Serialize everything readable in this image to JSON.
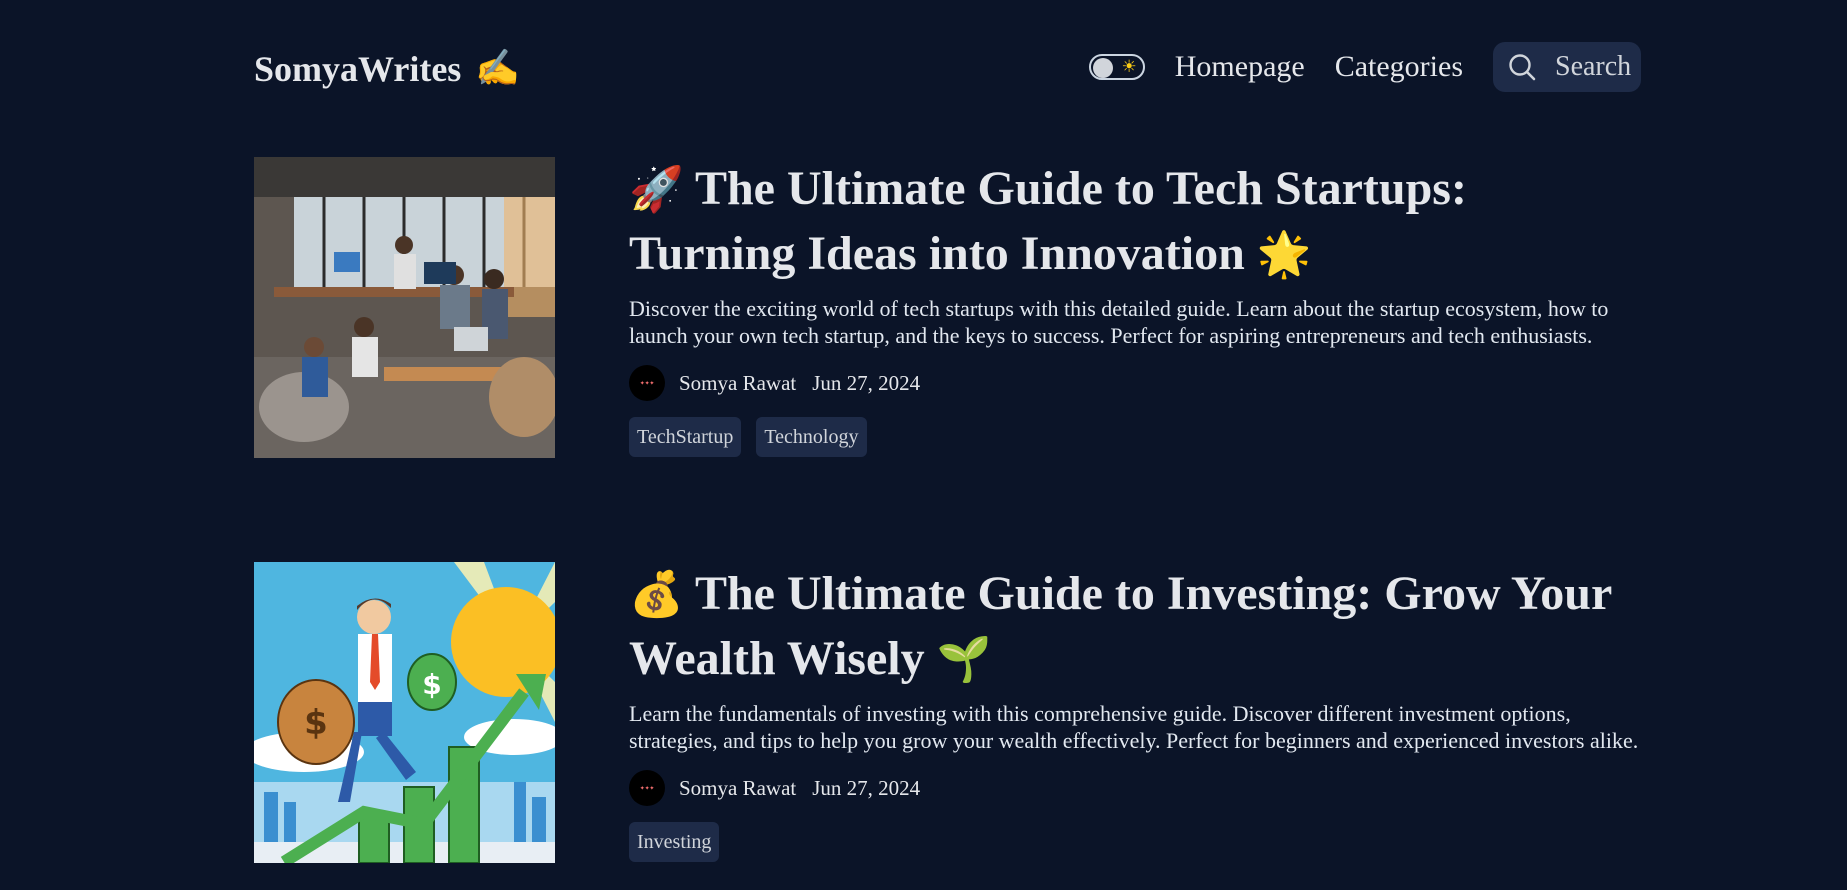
{
  "header": {
    "brand": "SomyaWrites",
    "brand_emoji": "✍️",
    "theme_toggle_icon": "sun-icon",
    "nav": {
      "home": "Homepage",
      "categories": "Categories"
    },
    "search_label": "Search"
  },
  "posts": [
    {
      "emoji_start": "🚀",
      "title": "The Ultimate Guide to Tech Startups: Turning Ideas into Innovation",
      "emoji_end": "🌟",
      "excerpt": "Discover the exciting world of tech startups with this detailed guide. Learn about the startup ecosystem, how to launch your own tech startup, and the keys to success. Perfect for aspiring entrepreneurs and tech enthusiasts.",
      "author": "Somya Rawat",
      "date": "Jun 27, 2024",
      "tags": [
        "TechStartup",
        "Technology"
      ]
    },
    {
      "emoji_start": "💰",
      "title": "The Ultimate Guide to Investing: Grow Your Wealth Wisely",
      "emoji_end": "🌱",
      "excerpt": "Learn the fundamentals of investing with this comprehensive guide. Discover different investment options, strategies, and tips to help you grow your wealth effectively. Perfect for beginners and experienced investors alike.",
      "author": "Somya Rawat",
      "date": "Jun 27, 2024",
      "tags": [
        "Investing"
      ]
    }
  ],
  "colors": {
    "background": "#0b1428",
    "surface": "#1e2b48",
    "text": "#e2e8f0"
  }
}
